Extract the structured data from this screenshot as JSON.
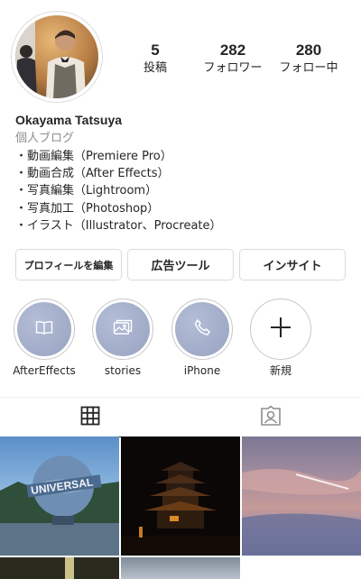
{
  "profile": {
    "username": "Okayama Tatsuya",
    "category": "個人ブログ",
    "bio": [
      "・動画編集（Premiere Pro）",
      "・動画合成（After Effects）",
      "・写真編集（Lightroom）",
      "・写真加工（Photoshop）",
      "・イラスト（Illustrator、Procreate）"
    ]
  },
  "stats": {
    "posts": {
      "value": "5",
      "label": "投稿"
    },
    "followers": {
      "value": "282",
      "label": "フォロワー"
    },
    "following": {
      "value": "280",
      "label": "フォロー中"
    }
  },
  "buttons": {
    "edit_profile": "プロフィールを編集",
    "ad_tools": "広告ツール",
    "insights": "インサイト"
  },
  "highlights": [
    {
      "label": "AfterEffects",
      "icon": "book-icon"
    },
    {
      "label": "stories",
      "icon": "image-icon"
    },
    {
      "label": "iPhone",
      "icon": "phone-icon"
    },
    {
      "label": "新規",
      "icon": "plus-icon"
    }
  ],
  "tabs": [
    {
      "icon": "grid-icon",
      "active": true
    },
    {
      "icon": "tagged-person-icon",
      "active": false
    }
  ],
  "colors": {
    "text": "#262626",
    "secondary": "#8e8e8e",
    "border": "#dbdbdb",
    "highlight_fill": "#a4aecb"
  }
}
